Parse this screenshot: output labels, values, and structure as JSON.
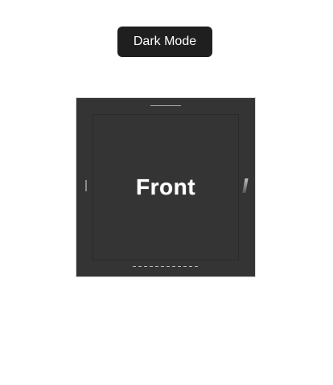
{
  "controls": {
    "theme_toggle_label": "Dark Mode"
  },
  "cube": {
    "front_label": "Front"
  }
}
